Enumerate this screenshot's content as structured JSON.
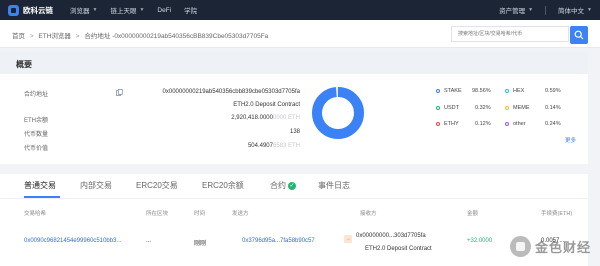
{
  "topbar": {
    "logo_text": "欧科云链",
    "nav": [
      {
        "label": "浏览器",
        "has_caret": true
      },
      {
        "label": "链上天眼",
        "has_caret": true
      },
      {
        "label": "DeFi",
        "has_caret": false
      },
      {
        "label": "学院",
        "has_caret": false
      }
    ],
    "asset_label": "资产管理",
    "lang_label": "简体中文"
  },
  "breadcrumb": {
    "home": "首页",
    "explorer": "ETH浏览器",
    "current": "合约地址 -0x00000000219ab540356cBB839Cbe05303d7705Fa"
  },
  "search": {
    "placeholder": "搜索地址/区块/交易哈希/代币"
  },
  "overview": {
    "title": "概要",
    "rows": [
      {
        "label": "合约地址",
        "value": "0x00000000219ab540356cbb839cbe05303d7705fa",
        "sub": "ETH2.0 Deposit Contract"
      },
      {
        "label": "ETH余额",
        "value": "2,920,418.0000",
        "muted": "0000 ETH"
      },
      {
        "label": "代币数量",
        "value": "138"
      },
      {
        "label": "代币价值",
        "value": "504.4907",
        "muted": "6583 ETH"
      }
    ],
    "legend": [
      {
        "name": "STAKE",
        "pct": "98.56%",
        "color": "#3b82f6"
      },
      {
        "name": "HEX",
        "pct": "0.59%",
        "color": "#22c3d6"
      },
      {
        "name": "USDT",
        "pct": "0.32%",
        "color": "#22b573"
      },
      {
        "name": "MEME",
        "pct": "0.14%",
        "color": "#f5b82e"
      },
      {
        "name": "ETHY",
        "pct": "0.12%",
        "color": "#e5484d"
      },
      {
        "name": "other",
        "pct": "0.24%",
        "color": "#8b5cf6"
      }
    ],
    "more": "更多"
  },
  "tabs": [
    {
      "label": "普通交易",
      "active": true
    },
    {
      "label": "内部交易",
      "active": false
    },
    {
      "label": "ERC20交易",
      "active": false
    },
    {
      "label": "ERC20余额",
      "active": false
    },
    {
      "label": "合约",
      "active": false,
      "verified": true
    },
    {
      "label": "事件日志",
      "active": false
    }
  ],
  "table": {
    "headers": [
      "交易哈希",
      "所在区块",
      "时间",
      "发送方",
      "接收方",
      "金额",
      "手续费(ETH)"
    ],
    "row": {
      "hash": "0x0090c96821454e99960c510bb3...",
      "block": "...",
      "time": "刚刚",
      "from": "0x3796d95a...7fa58b90c57",
      "to": "0x00000000...303d7705fa",
      "to_name": "ETH2.0 Deposit Contract",
      "amount": "+32.0000",
      "fee": "0.0057..."
    }
  },
  "watermark": "金色财经",
  "colors": {
    "accent": "#3b82f6",
    "topbar": "#1c2536",
    "success": "#22b573"
  }
}
